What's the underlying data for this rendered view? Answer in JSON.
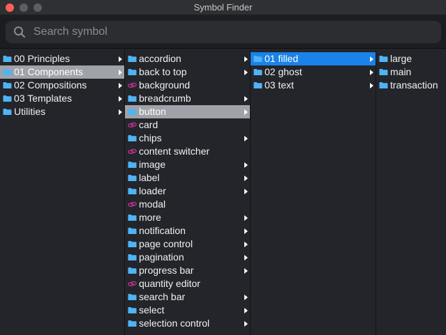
{
  "window": {
    "title": "Symbol Finder"
  },
  "search": {
    "placeholder": "Search symbol"
  },
  "colors": {
    "folder": "#4fb4f5",
    "symbol": "#c7329a",
    "selection_grey": "#9fa2a8",
    "selection_blue": "#1a82e8"
  },
  "columns": [
    {
      "items": [
        {
          "label": "00 Principles",
          "icon": "folder-icon",
          "arrow": true,
          "state": ""
        },
        {
          "label": "01 Components",
          "icon": "folder-icon",
          "arrow": true,
          "state": "grey"
        },
        {
          "label": "02 Compositions",
          "icon": "folder-icon",
          "arrow": true,
          "state": ""
        },
        {
          "label": "03 Templates",
          "icon": "folder-icon",
          "arrow": true,
          "state": ""
        },
        {
          "label": "Utilities",
          "icon": "folder-icon",
          "arrow": true,
          "state": ""
        }
      ]
    },
    {
      "items": [
        {
          "label": "accordion",
          "icon": "folder-icon",
          "arrow": true,
          "state": ""
        },
        {
          "label": "back to top",
          "icon": "folder-icon",
          "arrow": true,
          "state": ""
        },
        {
          "label": "background",
          "icon": "symbol-icon",
          "arrow": false,
          "state": ""
        },
        {
          "label": "breadcrumb",
          "icon": "folder-icon",
          "arrow": true,
          "state": ""
        },
        {
          "label": "button",
          "icon": "folder-icon",
          "arrow": true,
          "state": "grey"
        },
        {
          "label": "card",
          "icon": "symbol-icon",
          "arrow": false,
          "state": ""
        },
        {
          "label": "chips",
          "icon": "folder-icon",
          "arrow": true,
          "state": ""
        },
        {
          "label": "content switcher",
          "icon": "symbol-icon",
          "arrow": false,
          "state": ""
        },
        {
          "label": "image",
          "icon": "folder-icon",
          "arrow": true,
          "state": ""
        },
        {
          "label": "label",
          "icon": "folder-icon",
          "arrow": true,
          "state": ""
        },
        {
          "label": "loader",
          "icon": "folder-icon",
          "arrow": true,
          "state": ""
        },
        {
          "label": "modal",
          "icon": "symbol-icon",
          "arrow": false,
          "state": ""
        },
        {
          "label": "more",
          "icon": "folder-icon",
          "arrow": true,
          "state": ""
        },
        {
          "label": "notification",
          "icon": "folder-icon",
          "arrow": true,
          "state": ""
        },
        {
          "label": "page control",
          "icon": "folder-icon",
          "arrow": true,
          "state": ""
        },
        {
          "label": "pagination",
          "icon": "folder-icon",
          "arrow": true,
          "state": ""
        },
        {
          "label": "progress bar",
          "icon": "folder-icon",
          "arrow": true,
          "state": ""
        },
        {
          "label": "quantity editor",
          "icon": "symbol-icon",
          "arrow": false,
          "state": ""
        },
        {
          "label": "search bar",
          "icon": "folder-icon",
          "arrow": true,
          "state": ""
        },
        {
          "label": "select",
          "icon": "folder-icon",
          "arrow": true,
          "state": ""
        },
        {
          "label": "selection control",
          "icon": "folder-icon",
          "arrow": true,
          "state": ""
        }
      ]
    },
    {
      "items": [
        {
          "label": "01 filled",
          "icon": "folder-icon",
          "arrow": true,
          "state": "blue"
        },
        {
          "label": "02 ghost",
          "icon": "folder-icon",
          "arrow": true,
          "state": ""
        },
        {
          "label": "03 text",
          "icon": "folder-icon",
          "arrow": true,
          "state": ""
        }
      ]
    },
    {
      "items": [
        {
          "label": "large",
          "icon": "folder-icon",
          "arrow": false,
          "state": ""
        },
        {
          "label": "main",
          "icon": "folder-icon",
          "arrow": false,
          "state": ""
        },
        {
          "label": "transaction",
          "icon": "folder-icon",
          "arrow": false,
          "state": ""
        }
      ]
    }
  ]
}
